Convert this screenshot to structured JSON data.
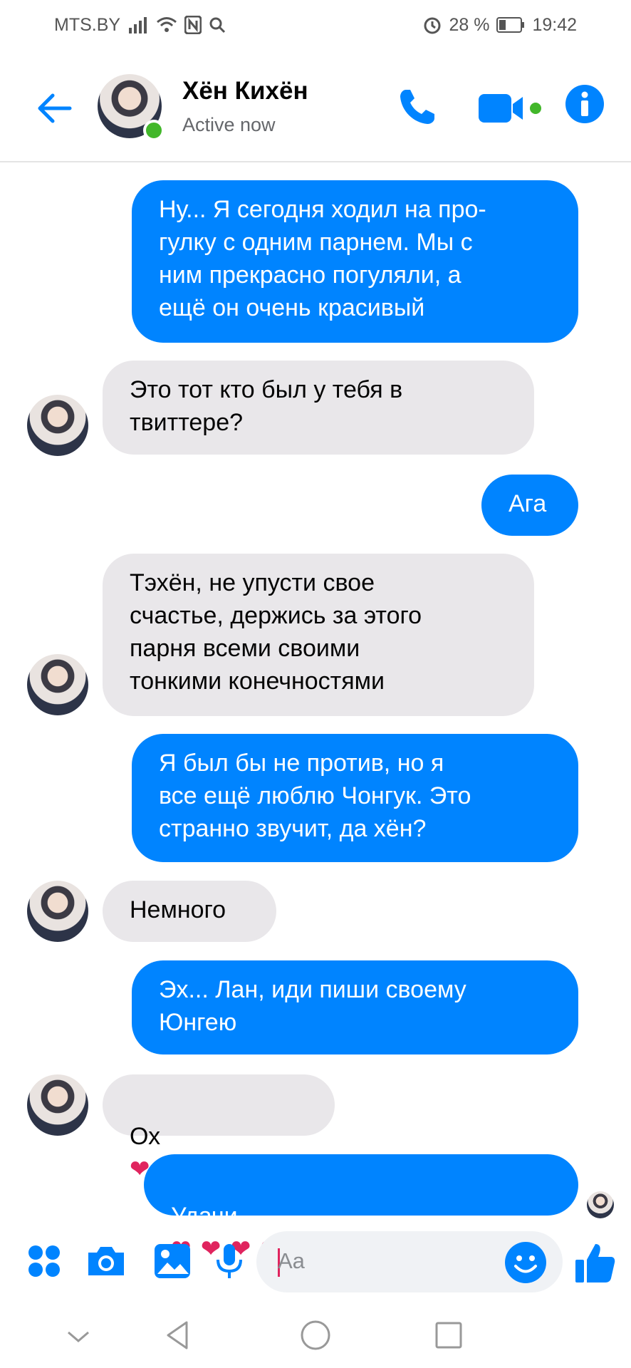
{
  "status_bar": {
    "carrier": "MTS.BY",
    "battery": "28 %",
    "time": "19:42"
  },
  "header": {
    "contact_name": "Хён Кихён",
    "contact_status": "Active now"
  },
  "messages": [
    {
      "direction": "out",
      "text": "Ну... Я сегодня ходил на про-\nгулку с одним парнем. Мы с\nним прекрасно погуляли, а\nещё он очень красивый"
    },
    {
      "direction": "in",
      "text": "Это тот кто был у тебя в\nтвиттере?"
    },
    {
      "direction": "out",
      "text": "Ага"
    },
    {
      "direction": "in",
      "text": "Тэхён, не упусти свое\nсчастье, держись за этого\nпарня всеми своими\nтонкими конечностями"
    },
    {
      "direction": "out",
      "text": "Я был бы не против, но я\nвсе ещё люблю Чонгук. Это\nстранно звучит, да хён?"
    },
    {
      "direction": "in",
      "text": "Немного"
    },
    {
      "direction": "out",
      "text": "Эх... Лан, иди пиши своему\nЮнгею"
    },
    {
      "direction": "in",
      "text": "Ох",
      "hearts": "❤❤❤❤"
    },
    {
      "direction": "out",
      "text": "Удачи",
      "hearts": "❤ ❤ ❤ ❤ ❤ ❤ ❤"
    }
  ],
  "composer": {
    "placeholder": "Aa"
  },
  "colors": {
    "accent": "#0084ff",
    "incoming_bubble": "#e9e7ea",
    "online": "#42b72a",
    "heart": "#e0245e"
  },
  "icons": [
    "back-arrow-icon",
    "phone-icon",
    "video-camera-icon",
    "info-icon",
    "grid-icon",
    "camera-icon",
    "image-icon",
    "microphone-icon",
    "smiley-icon",
    "thumbs-up-icon",
    "nav-down-icon",
    "nav-back-icon",
    "nav-home-icon",
    "nav-recents-icon"
  ]
}
